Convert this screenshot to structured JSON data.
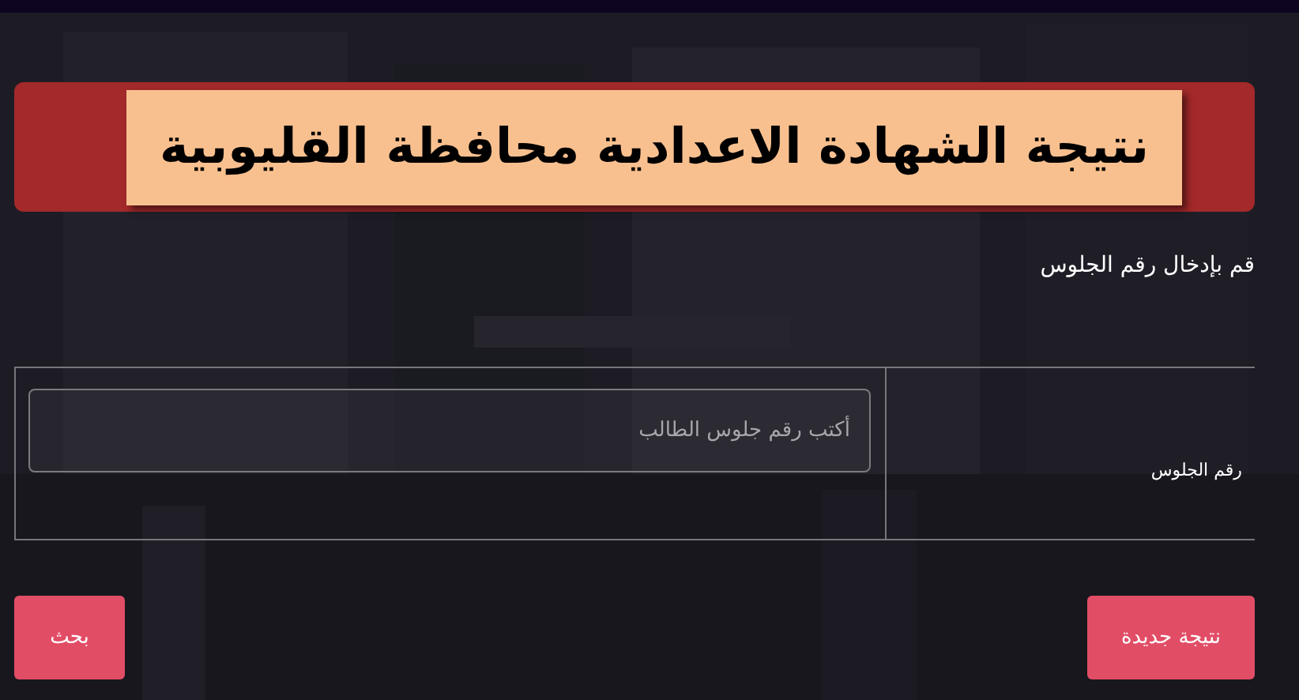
{
  "header": {
    "title": "نتيجة الشهادة الاعدادية محافظة القليوبية"
  },
  "form": {
    "prompt": "قم بإدخال رقم الجلوس",
    "row": {
      "label": "رقم الجلوس",
      "input": {
        "placeholder": "أكتب رقم جلوس الطالب"
      }
    },
    "buttons": [
      "نتيجة جديدة",
      "بحث"
    ]
  }
}
